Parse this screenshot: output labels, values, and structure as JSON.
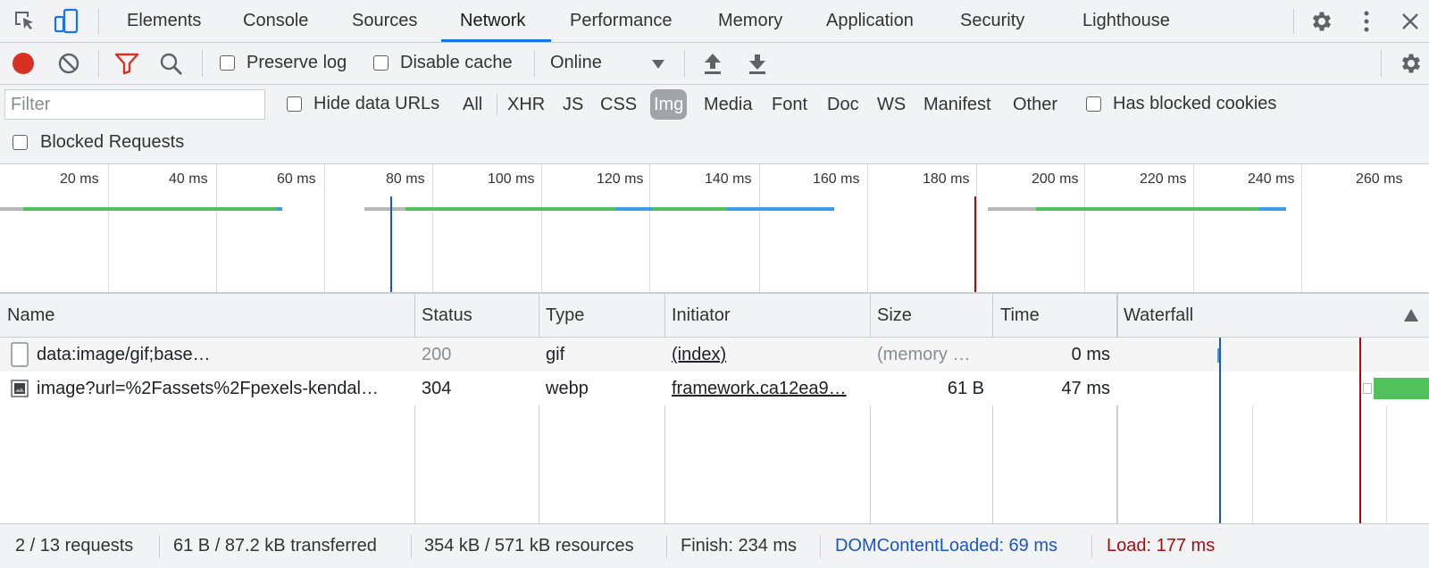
{
  "tabs": [
    "Elements",
    "Console",
    "Sources",
    "Network",
    "Performance",
    "Memory",
    "Application",
    "Security",
    "Lighthouse"
  ],
  "toolbar": {
    "preserve_log": "Preserve log",
    "disable_cache": "Disable cache",
    "throttle": "Online"
  },
  "filter": {
    "placeholder": "Filter",
    "hide_data_urls": "Hide data URLs",
    "types": [
      "All",
      "XHR",
      "JS",
      "CSS",
      "Img",
      "Media",
      "Font",
      "Doc",
      "WS",
      "Manifest",
      "Other"
    ],
    "selected_type": "Img",
    "has_blocked_cookies": "Has blocked cookies",
    "blocked_requests": "Blocked Requests"
  },
  "overview": {
    "ticks": [
      "20 ms",
      "40 ms",
      "60 ms",
      "80 ms",
      "100 ms",
      "120 ms",
      "140 ms",
      "160 ms",
      "180 ms",
      "200 ms",
      "220 ms",
      "240 ms",
      "260 ms"
    ]
  },
  "table": {
    "columns": [
      "Name",
      "Status",
      "Type",
      "Initiator",
      "Size",
      "Time",
      "Waterfall"
    ],
    "rows": [
      {
        "name": "data:image/gif;base…",
        "status": "200",
        "type": "gif",
        "initiator": "(index)",
        "size": "(memory …",
        "time": "0 ms"
      },
      {
        "name": "image?url=%2Fassets%2Fpexels-kendal…",
        "status": "304",
        "type": "webp",
        "initiator": "framework.ca12ea9…",
        "size": "61 B",
        "time": "47 ms"
      }
    ]
  },
  "status": {
    "requests": "2 / 13 requests",
    "transferred": "61 B / 87.2 kB transferred",
    "resources": "354 kB / 571 kB resources",
    "finish": "Finish: 234 ms",
    "dcl": "DOMContentLoaded: 69 ms",
    "load": "Load: 177 ms"
  },
  "colors": {
    "accent": "#1a73e8",
    "record": "#d93025",
    "dcl": "#1a56c5",
    "load": "#a50e0e",
    "waiting": "#4fc25b",
    "download": "#3d9be9"
  }
}
